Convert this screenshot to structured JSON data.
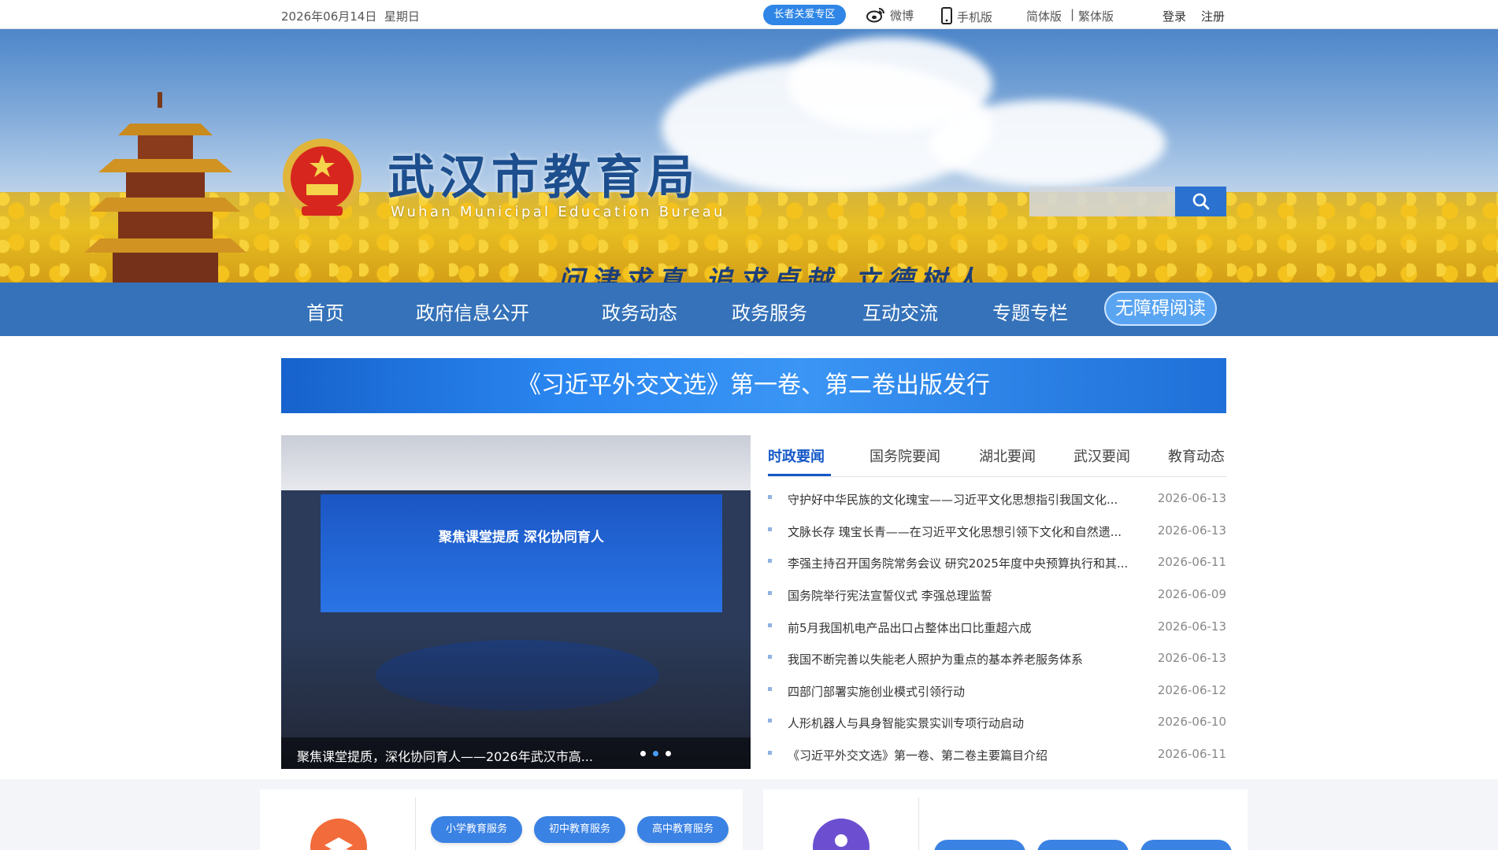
{
  "topbar": {
    "date": "2026年06月14日",
    "weekday": "星期日",
    "elder_zone": "长者关爱专区",
    "weibo": "微博",
    "mobile": "手机版",
    "simplified": "简体版",
    "separator": "|",
    "traditional": "繁体版",
    "login": "登录",
    "register": "注册"
  },
  "header": {
    "title": "武汉市教育局",
    "subtitle": "Wuhan Municipal Education Bureau",
    "motto": "问津求真  追求卓越  立德树人"
  },
  "search": {
    "placeholder": ""
  },
  "nav": {
    "items": [
      "首页",
      "政府信息公开",
      "政务动态",
      "政务服务",
      "互动交流",
      "专题专栏"
    ],
    "accessibility": "无障碍阅读"
  },
  "headline": "《习近平外交文选》第一卷、第二卷出版发行",
  "carousel": {
    "caption": "聚焦课堂提质，深化协同育人——2026年武汉市高...",
    "screen_title": "聚焦课堂提质  深化协同育人",
    "active_index": 2,
    "total": 3
  },
  "news": {
    "tabs": [
      "时政要闻",
      "国务院要闻",
      "湖北要闻",
      "武汉要闻",
      "教育动态"
    ],
    "active_tab": 0,
    "items": [
      {
        "title": "守护好中华民族的文化瑰宝——习近平文化思想指引我国文化...",
        "date": "2026-06-13"
      },
      {
        "title": "文脉长存 瑰宝长青——在习近平文化思想引领下文化和自然遗...",
        "date": "2026-06-13"
      },
      {
        "title": "李强主持召开国务院常务会议 研究2025年度中央预算执行和其...",
        "date": "2026-06-11"
      },
      {
        "title": "国务院举行宪法宣誓仪式 李强总理监誓",
        "date": "2026-06-09"
      },
      {
        "title": "前5月我国机电产品出口占整体出口比重超六成",
        "date": "2026-06-13"
      },
      {
        "title": "我国不断完善以失能老人照护为重点的基本养老服务体系",
        "date": "2026-06-13"
      },
      {
        "title": "四部门部署实施创业模式引领行动",
        "date": "2026-06-12"
      },
      {
        "title": "人形机器人与具身智能实景实训专项行动启动",
        "date": "2026-06-10"
      },
      {
        "title": "《习近平外交文选》第一卷、第二卷主要篇目介绍",
        "date": "2026-06-11"
      }
    ]
  },
  "services": {
    "left_pills": [
      "小学教育服务",
      "初中教育服务",
      "高中教育服务"
    ],
    "right_pills": [
      "",
      "",
      ""
    ]
  },
  "colors": {
    "nav_bg": "#3572b9",
    "accent": "#1458c8",
    "elder_btn": "#2f86e6",
    "orange_icon": "#f26b3a",
    "purple_icon": "#6c4fd1"
  }
}
